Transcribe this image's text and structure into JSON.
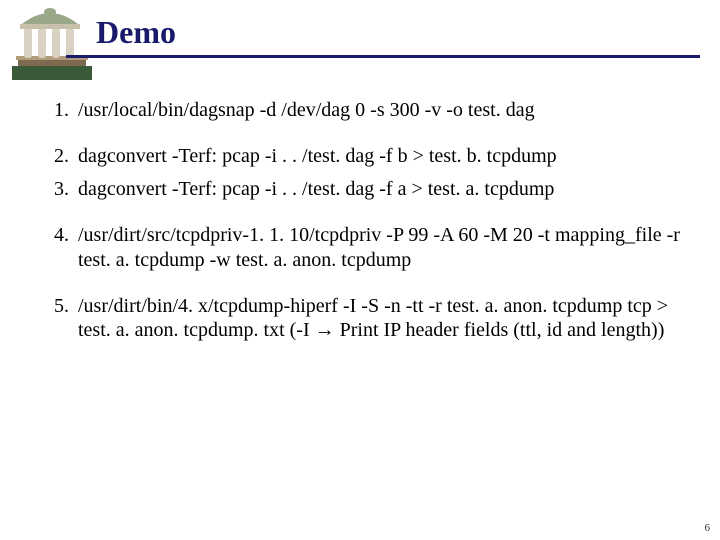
{
  "title": "Demo",
  "items": [
    "/usr/local/bin/dagsnap -d /dev/dag 0 -s 300 -v -o test. dag",
    "dagconvert -Terf: pcap -i . . /test. dag -f b > test. b. tcpdump",
    "dagconvert -Terf: pcap -i . . /test. dag -f a > test. a. tcpdump",
    "/usr/dirt/src/tcpdpriv-1. 1. 10/tcpdpriv -P 99 -A 60 -M 20 -t mapping_file -r test. a. tcpdump -w test. a. anon. tcpdump",
    "/usr/dirt/bin/4. x/tcpdump-hiperf -I -S -n -tt -r test. a. anon. tcpdump tcp > test. a. anon. tcpdump. txt (-I → Print IP header fields (ttl, id and length))"
  ],
  "page_number": "6"
}
